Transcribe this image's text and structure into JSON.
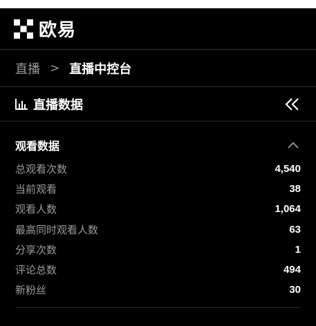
{
  "header": {
    "logo_icon": "okx-logo-icon",
    "brand": "欧易"
  },
  "breadcrumb": {
    "parent": "直播",
    "separator": ">",
    "current": "直播中控台"
  },
  "section": {
    "icon": "bar-chart-icon",
    "title": "直播数据",
    "collapse_icon": "double-chevron-left-icon"
  },
  "stats": {
    "title": "观看数据",
    "toggle_icon": "chevron-up-icon",
    "rows": [
      {
        "label": "总观看次数",
        "value": "4,540"
      },
      {
        "label": "当前观看",
        "value": "38"
      },
      {
        "label": "观看人数",
        "value": "1,064"
      },
      {
        "label": "最高同时观看人数",
        "value": "63"
      },
      {
        "label": "分享次数",
        "value": "1"
      },
      {
        "label": "评论总数",
        "value": "494"
      },
      {
        "label": "新粉丝",
        "value": "30"
      }
    ]
  },
  "colors": {
    "background": "#000000",
    "text_primary": "#ffffff",
    "text_secondary": "#9a9a9a",
    "divider": "#2b2b2b"
  }
}
